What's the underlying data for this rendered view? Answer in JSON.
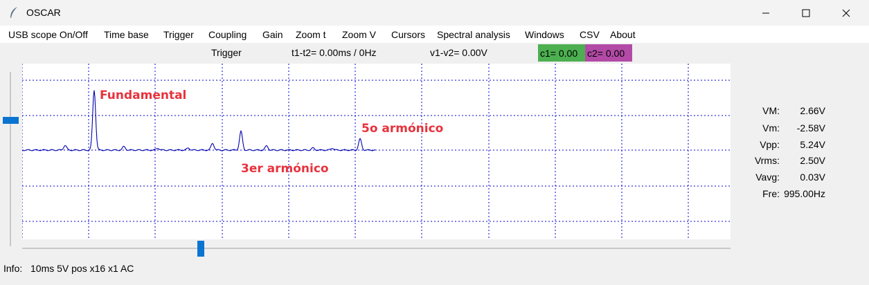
{
  "window": {
    "title": "OSCAR",
    "icons": {
      "app": "feather-icon",
      "minimize": "minimize-icon",
      "maximize": "maximize-icon",
      "close": "close-icon"
    }
  },
  "menu": [
    "USB scope On/Off",
    "Time base",
    "Trigger",
    "Coupling",
    "Gain",
    "Zoom t",
    "Zoom V",
    "Cursors",
    "Spectral analysis",
    "Windows",
    "CSV",
    "About"
  ],
  "status": {
    "trigger": "Trigger",
    "t_delta": "t1-t2= 0.00ms / 0Hz",
    "v_delta": "v1-v2= 0.00V",
    "c1": "c1=  0.00",
    "c2": "c2=  0.00",
    "c1_color": "#4caf50",
    "c2_color": "#b34aa6"
  },
  "plot": {
    "trace_color": "#0000aa",
    "grid_color": "#0000cc",
    "annotation_color": "#e8323c",
    "annotations": [
      "Fundamental",
      "5o armónico",
      "3er armónico"
    ]
  },
  "measurements": [
    {
      "label": "VM:",
      "value": "2.66V"
    },
    {
      "label": "Vm:",
      "value": "-2.58V"
    },
    {
      "label": "Vpp:",
      "value": "5.24V"
    },
    {
      "label": "Vrms:",
      "value": "2.50V"
    },
    {
      "label": "Vavg:",
      "value": "0.03V"
    },
    {
      "label": "Fre:",
      "value": "995.00Hz"
    }
  ],
  "info": {
    "label": "Info:",
    "value": "10ms 5V pos x16 x1 AC"
  }
}
